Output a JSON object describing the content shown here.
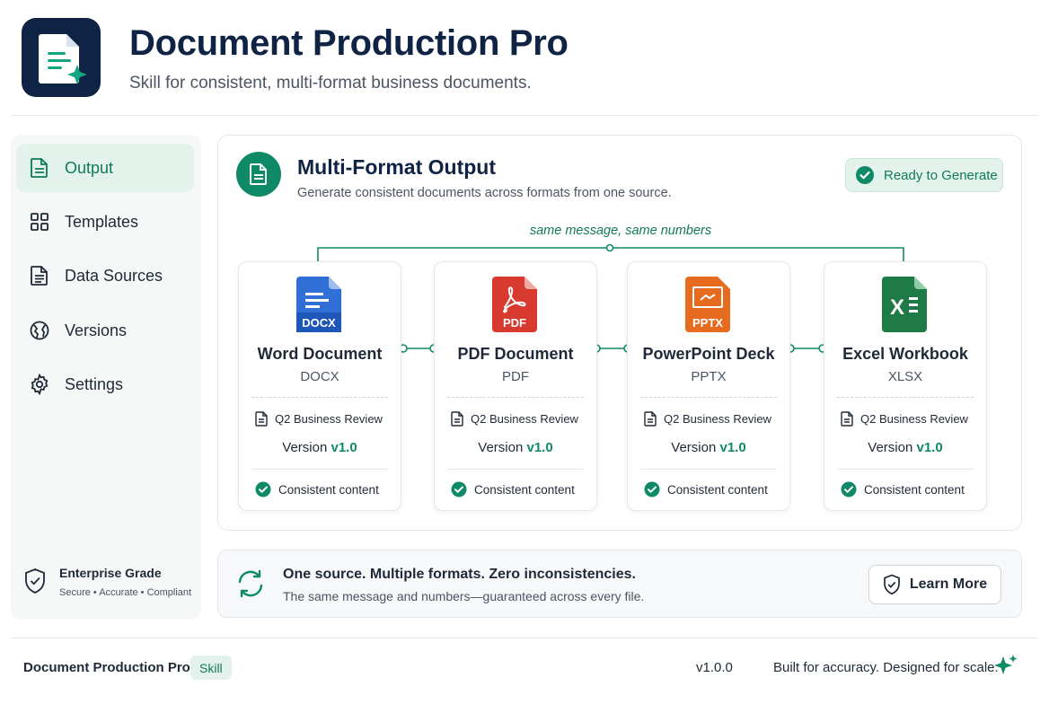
{
  "header": {
    "title": "Document Production Pro",
    "subtitle": "Skill for consistent, multi-format business documents.",
    "logo_icon": "document-sparkle-icon"
  },
  "sidebar": {
    "items": [
      {
        "label": "Output",
        "icon": "document-icon",
        "active": true
      },
      {
        "label": "Templates",
        "icon": "grid-icon",
        "active": false
      },
      {
        "label": "Data Sources",
        "icon": "file-list-icon",
        "active": false
      },
      {
        "label": "Versions",
        "icon": "history-icon",
        "active": false
      },
      {
        "label": "Settings",
        "icon": "gear-icon",
        "active": false
      }
    ],
    "enterprise": {
      "title": "Enterprise Grade",
      "subtitle": "Secure • Accurate • Compliant"
    }
  },
  "main": {
    "title": "Multi-Format Output",
    "subtitle": "Generate consistent documents across formats from one source.",
    "status_badge": "Ready to Generate",
    "connector_label": "same message, same numbers",
    "cards": [
      {
        "title": "Word Document",
        "ext": "DOCX",
        "icon_text": "DOCX",
        "color": "#2f6fd6",
        "doc_name": "Q2 Business Review",
        "version_prefix": "Version",
        "version": "v1.0",
        "status": "Consistent content"
      },
      {
        "title": "PDF Document",
        "ext": "PDF",
        "icon_text": "PDF",
        "color": "#d93a30",
        "doc_name": "Q2 Business Review",
        "version_prefix": "Version",
        "version": "v1.0",
        "status": "Consistent content"
      },
      {
        "title": "PowerPoint Deck",
        "ext": "PPTX",
        "icon_text": "PPTX",
        "color": "#e66b1f",
        "doc_name": "Q2 Business Review",
        "version_prefix": "Version",
        "version": "v1.0",
        "status": "Consistent content"
      },
      {
        "title": "Excel Workbook",
        "ext": "XLSX",
        "icon_text": "X",
        "color": "#1e7b45",
        "doc_name": "Q2 Business Review",
        "version_prefix": "Version",
        "version": "v1.0",
        "status": "Consistent content"
      }
    ]
  },
  "banner": {
    "title": "One source. Multiple formats. Zero inconsistencies.",
    "subtitle": "The same message and numbers—guaranteed across every file.",
    "button_label": "Learn More"
  },
  "footer": {
    "name": "Document Production Pro",
    "badge": "Skill",
    "version": "v1.0.0",
    "tagline": "Built for accuracy. Designed for scale."
  },
  "colors": {
    "accent": "#0f8a67",
    "navy": "#0f2344",
    "active_bg": "#e4f2ec"
  }
}
